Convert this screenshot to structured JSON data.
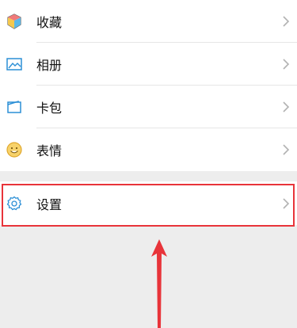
{
  "menu": {
    "items": [
      {
        "label": "收藏",
        "icon": "favorites-icon"
      },
      {
        "label": "相册",
        "icon": "album-icon"
      },
      {
        "label": "卡包",
        "icon": "card-wallet-icon"
      },
      {
        "label": "表情",
        "icon": "sticker-icon"
      }
    ],
    "settings": {
      "label": "设置",
      "icon": "gear-icon"
    }
  },
  "annotation": {
    "highlight_color": "#e8343a",
    "arrow_color": "#e8343a"
  },
  "colors": {
    "background": "#ededed",
    "row": "#ffffff",
    "text": "#111111",
    "chevron": "#b2b2b2"
  }
}
